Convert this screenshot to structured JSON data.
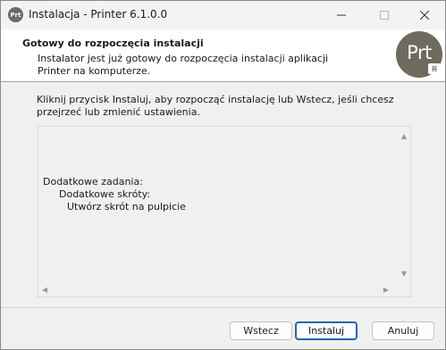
{
  "window": {
    "title": "Instalacja - Printer 6.1.0.0",
    "app_icon_text": "Prt"
  },
  "header": {
    "title": "Gotowy do rozpoczęcia instalacji",
    "description": "Instalator jest już gotowy do rozpoczęcia instalacji aplikacji Printer na komputerze.",
    "logo_text": "Prt",
    "logo_badge": "䷳"
  },
  "intro_text": "Kliknij przycisk Instaluj, aby rozpocząć instalację lub Wstecz, jeśli chcesz przejrzeć lub zmienić ustawienia.",
  "memo": {
    "lines": [
      "Dodatkowe zadania:",
      "Dodatkowe skróty:",
      "Utwórz skrót na pulpicie"
    ]
  },
  "buttons": {
    "back": "Wstecz",
    "install": "Instaluj",
    "cancel": "Anuluj"
  },
  "icons": {
    "minimize": "minimize-icon",
    "maximize": "maximize-icon",
    "close": "close-icon"
  }
}
